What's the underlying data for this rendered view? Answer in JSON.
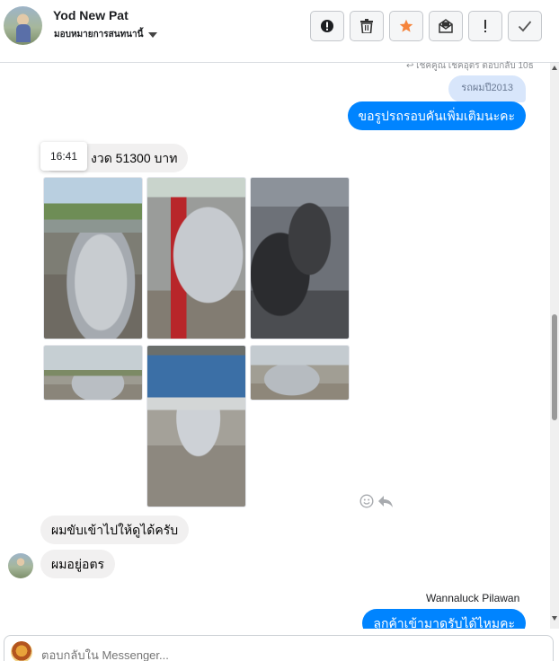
{
  "header": {
    "contact_name": "Yod New Pat",
    "contact_status": "มอบหมายการสนทนานี้",
    "toolbar": [
      {
        "name": "report-spam-button",
        "icon": "exclamation-circle-icon"
      },
      {
        "name": "delete-button",
        "icon": "trash-icon"
      },
      {
        "name": "star-button",
        "icon": "star-icon",
        "color": "#f5833b"
      },
      {
        "name": "mark-unread-button",
        "icon": "envelope-open-icon"
      },
      {
        "name": "follow-up-button",
        "icon": "exclamation-icon"
      },
      {
        "name": "mark-done-button",
        "icon": "check-icon"
      }
    ]
  },
  "chat": {
    "faded_note": "↩ เชคคูณ เชคอุตร ตอบกลับ 10ธ",
    "quoted_text": "รถผมปี2013",
    "outgoing_1": "ขอรูปรถรอบคันเพิ่มเติมนะคะ",
    "time_tooltip": "16:41",
    "incoming_price": "งวด 51300 บาท",
    "incoming_2": "ผมขับเข้าไปให้ดูได้ครับ",
    "incoming_3": "ผมอยู่อตร",
    "sender_name": "Wannaluck Pilawan",
    "outgoing_2_partial": "ลูกค้าเข้ามาดูรับได้ไหมคะ"
  },
  "photos": [
    {
      "name": "photo-front-truck",
      "alt": "front view of silver pickup"
    },
    {
      "name": "photo-rear-taillight",
      "alt": "rear tail light"
    },
    {
      "name": "photo-interior",
      "alt": "cab interior"
    },
    {
      "name": "photo-side-view",
      "alt": "side view"
    },
    {
      "name": "photo-rear-ranger",
      "alt": "rear tailgate RANGER"
    },
    {
      "name": "photo-side-view-2",
      "alt": "side view at shop"
    }
  ],
  "composer": {
    "placeholder": "ตอบกลับใน Messenger..."
  },
  "colors": {
    "outgoing_bubble": "#0084ff",
    "incoming_bubble": "#f1f0f0",
    "quoted_bubble": "#d8e6fb"
  }
}
